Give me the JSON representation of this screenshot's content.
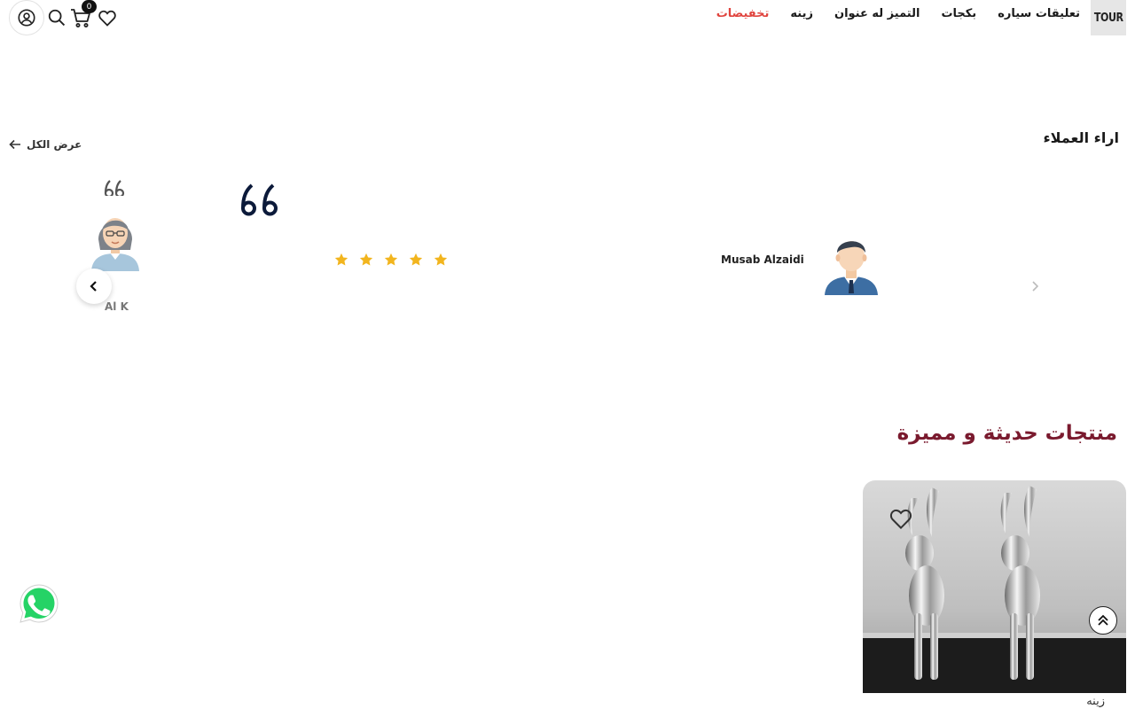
{
  "header": {
    "logo_text": "TOUR",
    "nav": [
      "تعليقات سياره",
      "بكجات",
      "التميز له عنوان",
      "زينه",
      "تخفيضات"
    ],
    "cart_count": "0",
    "sale_color": "#e0443e"
  },
  "testimonials": {
    "title": "اراء العملاء",
    "view_all": "عرض الكل",
    "items": [
      {
        "name": "Musab Alzaidi",
        "rating": 5
      },
      {
        "name": "Al K"
      }
    ],
    "star_color": "#f2b51e"
  },
  "products": {
    "title": "منتجات حديثة و مميزة",
    "title_color": "#7a1a2e",
    "first_category": "زينه"
  },
  "icons": [
    "account-icon",
    "search-icon",
    "cart-icon",
    "heart-icon",
    "quote-icon",
    "star-icon",
    "chevron-left-icon",
    "chevron-right-icon",
    "arrow-left-icon",
    "double-chevron-up-icon",
    "whatsapp-icon"
  ]
}
